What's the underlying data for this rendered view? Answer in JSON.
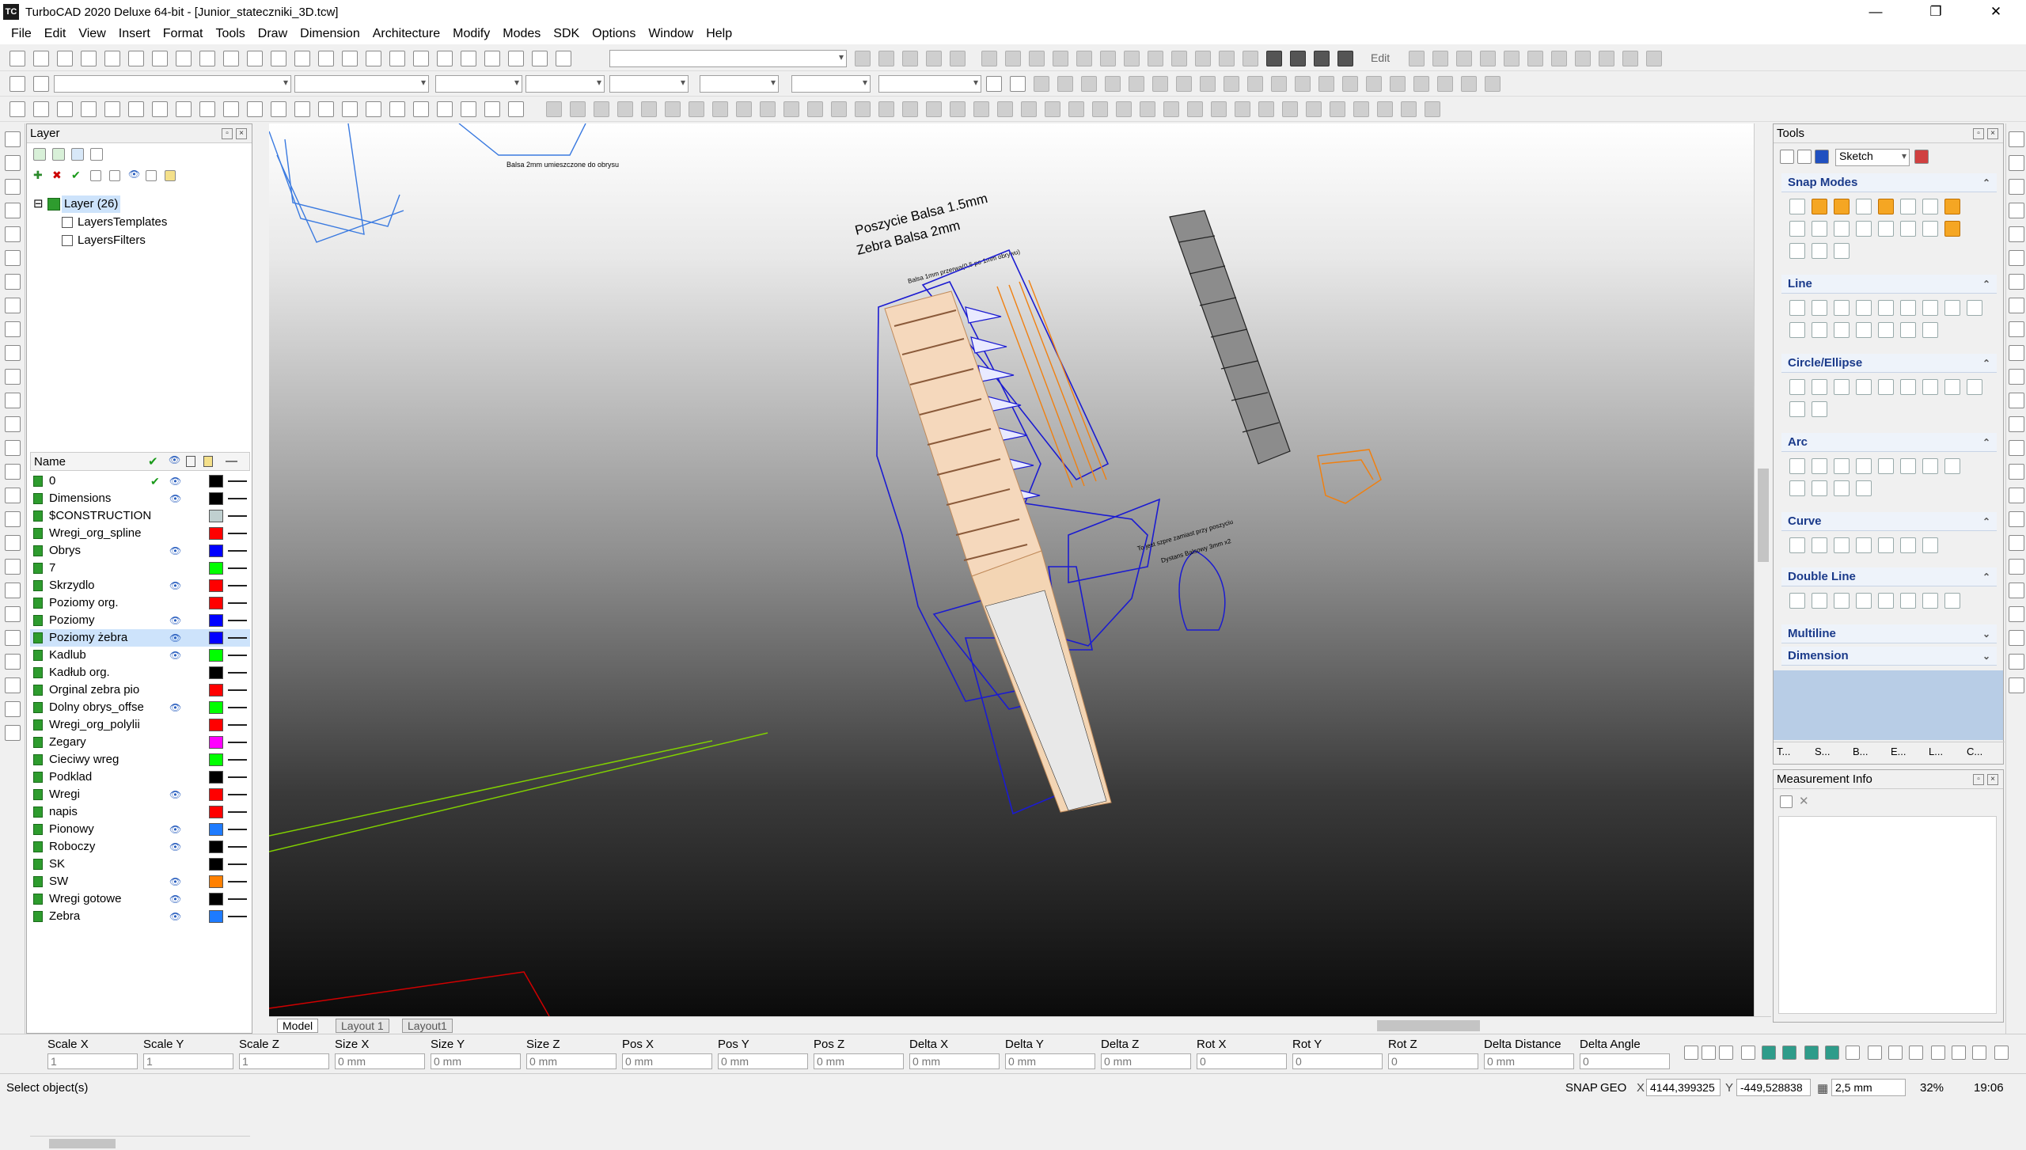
{
  "window": {
    "title": "TurboCAD 2020 Deluxe 64-bit - [Junior_stateczniki_3D.tcw]",
    "app_icon": "TC",
    "min": "—",
    "max": "❐",
    "close": "✕"
  },
  "menu": [
    "File",
    "Edit",
    "View",
    "Insert",
    "Format",
    "Tools",
    "Draw",
    "Dimension",
    "Architecture",
    "Modify",
    "Modes",
    "SDK",
    "Options",
    "Window",
    "Help"
  ],
  "toolbar": {
    "edit_label": "Edit"
  },
  "layer_panel": {
    "title": "Layer",
    "tree": [
      {
        "label": "Layer (26)"
      },
      {
        "label": "LayersTemplates"
      },
      {
        "label": "LayersFilters"
      }
    ],
    "column_name": "Name",
    "rows": [
      {
        "name": "0",
        "color": "#000000",
        "visible": true,
        "current": true
      },
      {
        "name": "Dimensions",
        "color": "#000000",
        "visible": true
      },
      {
        "name": "$CONSTRUCTION",
        "color": "#c0d0d0",
        "visible": false
      },
      {
        "name": "Wregi_org_spline",
        "color": "#ff0000",
        "visible": false
      },
      {
        "name": "Obrys",
        "color": "#0000ff",
        "visible": true
      },
      {
        "name": "7",
        "color": "#00ff00",
        "visible": false
      },
      {
        "name": "Skrzydlo",
        "color": "#ff0000",
        "visible": true
      },
      {
        "name": "Poziomy org.",
        "color": "#ff0000",
        "visible": false
      },
      {
        "name": "Poziomy",
        "color": "#0000ff",
        "visible": true
      },
      {
        "name": "Poziomy żebra",
        "color": "#0000ff",
        "visible": true,
        "selected": true
      },
      {
        "name": "Kadlub",
        "color": "#00ff00",
        "visible": true
      },
      {
        "name": "Kadłub org.",
        "color": "#000000",
        "visible": false
      },
      {
        "name": "Orginal zebra pio",
        "color": "#ff0000",
        "visible": false
      },
      {
        "name": "Dolny obrys_offse",
        "color": "#00ff00",
        "visible": true
      },
      {
        "name": "Wregi_org_polylii",
        "color": "#ff0000",
        "visible": false
      },
      {
        "name": "Zegary",
        "color": "#ff00ff",
        "visible": false
      },
      {
        "name": "Cieciwy wreg",
        "color": "#00ff00",
        "visible": false
      },
      {
        "name": "Podklad",
        "color": "#000000",
        "visible": false
      },
      {
        "name": "Wregi",
        "color": "#ff0000",
        "visible": true
      },
      {
        "name": "napis",
        "color": "#ff0000",
        "visible": false
      },
      {
        "name": "Pionowy",
        "color": "#1e7bff",
        "visible": true
      },
      {
        "name": "Roboczy",
        "color": "#000000",
        "visible": true
      },
      {
        "name": "SK",
        "color": "#000000",
        "visible": false
      },
      {
        "name": "SW",
        "color": "#ff8000",
        "visible": true
      },
      {
        "name": "Wregi gotowe",
        "color": "#000000",
        "visible": true
      },
      {
        "name": "Zebra",
        "color": "#1e7bff",
        "visible": true
      }
    ]
  },
  "drawing": {
    "text1": "Poszycie Balsa 1.5mm",
    "text2": "Zebra Balsa 2mm",
    "note1": "Balsa 2mm umieszczone do obrysu",
    "note2": "Balsa 1mm przerwa(0,5 po 1mm obrywu)",
    "note3": "To jest szpre zamiast przy poszyciu",
    "note4": "Dystans Balsowy 3mm x2"
  },
  "layout_tabs": [
    "Model",
    "Layout 1",
    "Layout1"
  ],
  "tools_panel": {
    "title": "Tools",
    "mode": "Sketch",
    "sections": [
      "Snap Modes",
      "Line",
      "Circle/Ellipse",
      "Arc",
      "Curve",
      "Double Line",
      "Multiline",
      "Dimension"
    ],
    "bottom_tabs": [
      "T...",
      "S...",
      "B...",
      "E...",
      "L...",
      "C..."
    ]
  },
  "measure_panel": {
    "title": "Measurement Info"
  },
  "coord_fields": [
    {
      "label": "Scale X",
      "value": "1"
    },
    {
      "label": "Scale Y",
      "value": "1"
    },
    {
      "label": "Scale Z",
      "value": "1"
    },
    {
      "label": "Size X",
      "value": "0 mm"
    },
    {
      "label": "Size Y",
      "value": "0 mm"
    },
    {
      "label": "Size Z",
      "value": "0 mm"
    },
    {
      "label": "Pos X",
      "value": "0 mm"
    },
    {
      "label": "Pos Y",
      "value": "0 mm"
    },
    {
      "label": "Pos Z",
      "value": "0 mm"
    },
    {
      "label": "Delta X",
      "value": "0 mm"
    },
    {
      "label": "Delta Y",
      "value": "0 mm"
    },
    {
      "label": "Delta Z",
      "value": "0 mm"
    },
    {
      "label": "Rot X",
      "value": "0"
    },
    {
      "label": "Rot Y",
      "value": "0"
    },
    {
      "label": "Rot Z",
      "value": "0"
    },
    {
      "label": "Delta Distance",
      "value": "0 mm"
    },
    {
      "label": "Delta Angle",
      "value": "0"
    }
  ],
  "status": {
    "prompt": "Select object(s)",
    "snap": "SNAP",
    "geo": "GEO",
    "x_coord": "4144,399325",
    "y_coord": "-449,528838",
    "grid": "2,5 mm",
    "zoom": "32%",
    "time": "19:06"
  }
}
